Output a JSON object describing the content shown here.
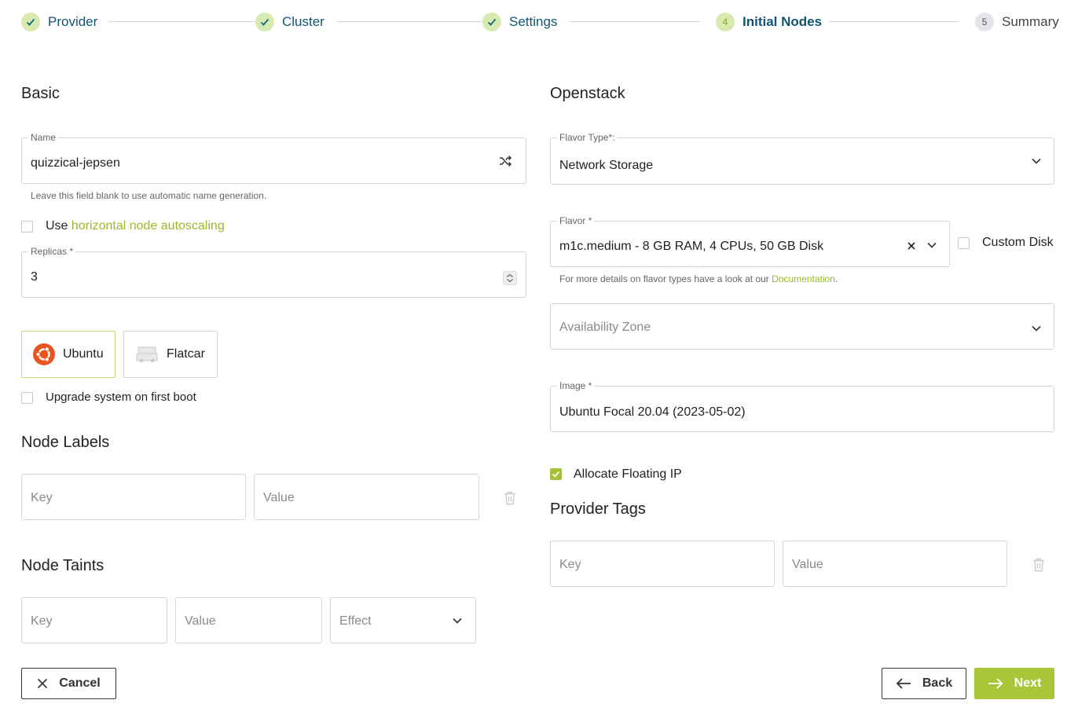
{
  "stepper": {
    "steps": [
      {
        "label": "Provider",
        "state": "done"
      },
      {
        "label": "Cluster",
        "state": "done"
      },
      {
        "label": "Settings",
        "state": "done"
      },
      {
        "label": "Initial Nodes",
        "number": "4",
        "state": "current"
      },
      {
        "label": "Summary",
        "number": "5",
        "state": "todo"
      }
    ]
  },
  "basic": {
    "heading": "Basic",
    "name": {
      "label": "Name",
      "value": "quizzical-jepsen",
      "hint": "Leave this field blank to use automatic name generation."
    },
    "autoscaling": {
      "prefix": "Use",
      "link": "horizontal node autoscaling",
      "checked": false
    },
    "replicas": {
      "label": "Replicas *",
      "value": "3"
    },
    "os": [
      {
        "label": "Ubuntu",
        "icon": "ubuntu-logo-icon",
        "selected": true
      },
      {
        "label": "Flatcar",
        "icon": "flatcar-logo-icon",
        "selected": false
      }
    ],
    "upgrade_on_boot": {
      "label": "Upgrade system on first boot",
      "checked": false
    }
  },
  "node_labels": {
    "heading": "Node Labels",
    "key_placeholder": "Key",
    "value_placeholder": "Value"
  },
  "node_taints": {
    "heading": "Node Taints",
    "key_placeholder": "Key",
    "value_placeholder": "Value",
    "effect_placeholder": "Effect"
  },
  "openstack": {
    "heading": "Openstack",
    "flavor_type": {
      "label": "Flavor Type*:",
      "value": "Network Storage"
    },
    "flavor": {
      "label": "Flavor *",
      "value": "m1c.medium - 8 GB RAM, 4 CPUs, 50 GB Disk",
      "hint_prefix": "For more details on flavor types have a look at our ",
      "hint_link": "Documentation",
      "hint_suffix": "."
    },
    "custom_disk": {
      "label": "Custom Disk",
      "checked": false
    },
    "availability_zone": {
      "placeholder": "Availability Zone"
    },
    "image": {
      "label": "Image *",
      "value": "Ubuntu Focal 20.04 (2023-05-02)"
    },
    "floating_ip": {
      "label": "Allocate Floating IP",
      "checked": true
    }
  },
  "provider_tags": {
    "heading": "Provider Tags",
    "key_placeholder": "Key",
    "value_placeholder": "Value"
  },
  "footer": {
    "cancel": "Cancel",
    "back": "Back",
    "next": "Next"
  },
  "colors": {
    "accent": "#a9c639",
    "link": "#9ab92a",
    "step_text": "#0f5573"
  }
}
